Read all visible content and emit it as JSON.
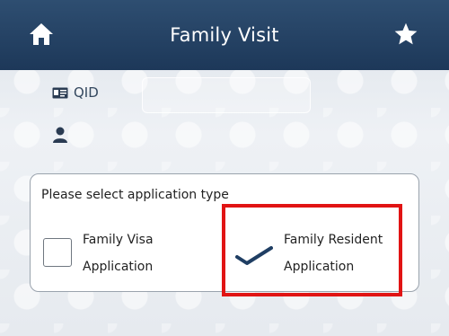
{
  "header": {
    "title": "Family Visit",
    "bg_color": "#23426a",
    "home_icon": "home-icon",
    "star_icon": "star-icon"
  },
  "form": {
    "qid_label": "QID",
    "qid_value": "",
    "user_value": ""
  },
  "card": {
    "prompt": "Please select application type",
    "options": [
      {
        "label_line1": "Family Visa",
        "label_line2": "Application",
        "checked": false
      },
      {
        "label_line1": "Family Resident",
        "label_line2": "Application",
        "checked": true
      }
    ]
  },
  "annotation": {
    "color": "#e11414"
  }
}
